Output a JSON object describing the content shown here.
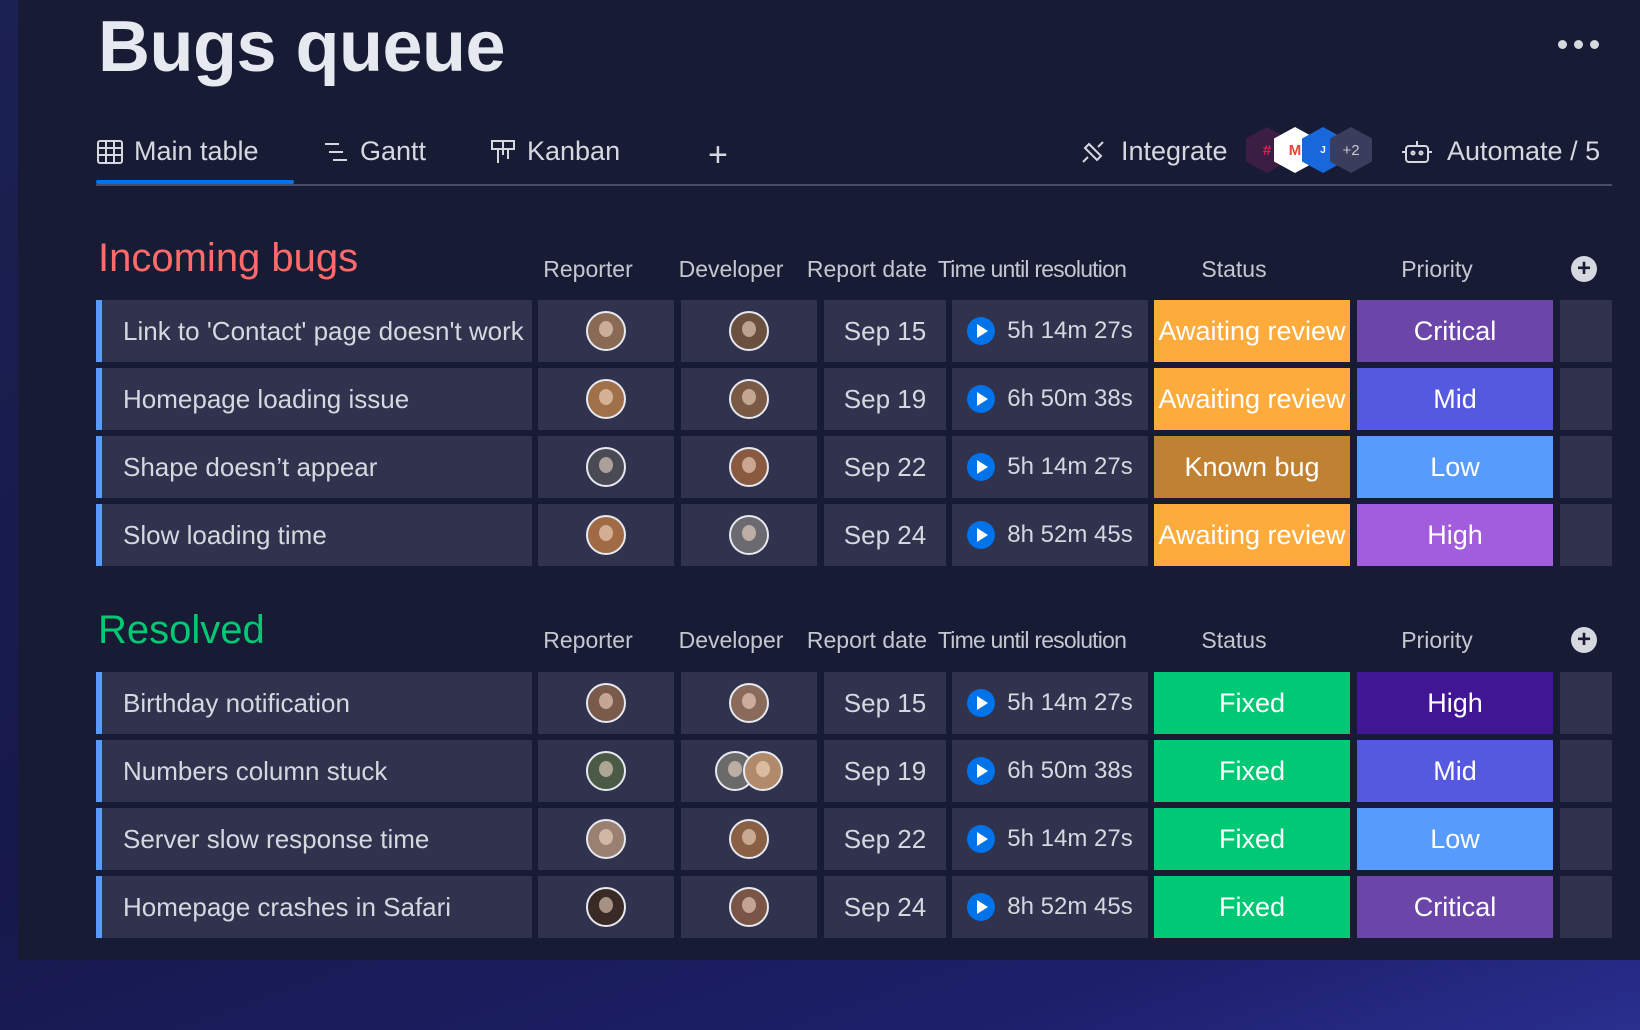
{
  "page_title": "Bugs queue",
  "tabs": [
    {
      "label": "Main table",
      "icon": "table-icon",
      "active": true
    },
    {
      "label": "Gantt",
      "icon": "gantt-icon",
      "active": false
    },
    {
      "label": "Kanban",
      "icon": "kanban-icon",
      "active": false
    }
  ],
  "add_view": "+",
  "integrate": {
    "label": "Integrate",
    "more_count": "+2",
    "apps": [
      "slack",
      "gmail",
      "jira"
    ]
  },
  "automate": {
    "label": "Automate / 5"
  },
  "columns": [
    "Reporter",
    "Developer",
    "Report date",
    "Time until resolution",
    "Status",
    "Priority"
  ],
  "resolved_columns": [
    "Reporter",
    "Developer",
    "Report date",
    "Time until resolution",
    "Status",
    "Priority"
  ],
  "colors": {
    "awaiting_review": "#fdab3d",
    "known_bug": "#c08132",
    "fixed": "#00c875",
    "critical": "#6b45a8",
    "mid": "#5559df",
    "low": "#579bfc",
    "high_incoming": "#a25ddc",
    "high_resolved": "#401694",
    "incoming_title": "#ff6b6b",
    "resolved_title": "#00c875"
  },
  "groups": [
    {
      "title": "Incoming bugs",
      "color": "#ff6b6b",
      "rows": [
        {
          "name": "Link to 'Contact' page doesn't work",
          "reporter_color": "#8a6a55",
          "developer_color": "#6b5040",
          "date": "Sep 15",
          "time": "5h 14m 27s",
          "status": "Awaiting review",
          "status_color": "#fdab3d",
          "priority": "Critical",
          "priority_color": "#6b45a8"
        },
        {
          "name": "Homepage loading issue",
          "reporter_color": "#a0704a",
          "developer_color": "#7a5a45",
          "date": "Sep 19",
          "time": "6h 50m 38s",
          "status": "Awaiting review",
          "status_color": "#fdab3d",
          "priority": "Mid",
          "priority_color": "#5559df"
        },
        {
          "name": "Shape doesn’t appear",
          "reporter_color": "#4a4a55",
          "developer_color": "#8a5a40",
          "date": "Sep 22",
          "time": "5h 14m 27s",
          "status": "Known bug",
          "status_color": "#c08132",
          "priority": "Low",
          "priority_color": "#579bfc"
        },
        {
          "name": "Slow loading time",
          "reporter_color": "#a06a45",
          "developer_color": "#6a6a70",
          "date": "Sep 24",
          "time": "8h 52m 45s",
          "status": "Awaiting review",
          "status_color": "#fdab3d",
          "priority": "High",
          "priority_color": "#a25ddc"
        }
      ]
    },
    {
      "title": "Resolved",
      "color": "#00c875",
      "rows": [
        {
          "name": "Birthday notification",
          "reporter_color": "#7a5a4a",
          "developer_color": "#8a6a5a",
          "date": "Sep 15",
          "time": "5h 14m 27s",
          "status": "Fixed",
          "status_color": "#00c875",
          "priority": "High",
          "priority_color": "#401694"
        },
        {
          "name": "Numbers column stuck",
          "reporter_color": "#4a5a45",
          "developer_color": "#6a6a6a",
          "date": "Sep 19",
          "time": "6h 50m 38s",
          "status": "Fixed",
          "status_color": "#00c875",
          "priority": "Mid",
          "priority_color": "#5559df"
        },
        {
          "name": "Server slow response time",
          "reporter_color": "#9a8070",
          "developer_color": "#8a6045",
          "date": "Sep 22",
          "time": "5h 14m 27s",
          "status": "Fixed",
          "status_color": "#00c875",
          "priority": "Low",
          "priority_color": "#579bfc"
        },
        {
          "name": "Homepage crashes in Safari",
          "reporter_color": "#3a2a25",
          "developer_color": "#7a5545",
          "date": "Sep 24",
          "time": "8h 52m 45s",
          "status": "Fixed",
          "status_color": "#00c875",
          "priority": "Critical",
          "priority_color": "#6b45a8"
        }
      ]
    }
  ]
}
